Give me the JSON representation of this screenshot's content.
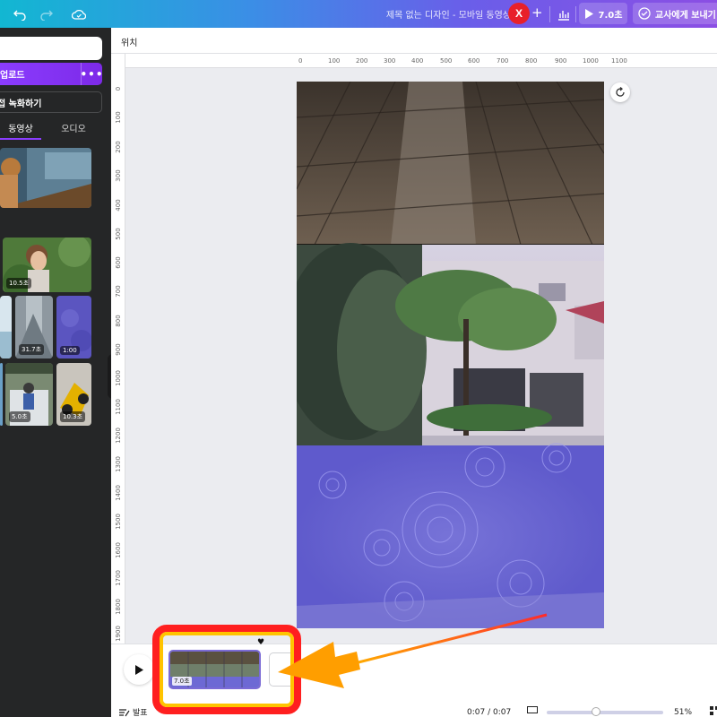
{
  "topbar": {
    "title": "제목 없는 디자인 - 모바일 동영상",
    "avatar_letter": "X",
    "add": "+",
    "play_duration": "7.0초",
    "send_teacher": "교사에게 보내기"
  },
  "sidebar": {
    "upload_label": "업로드",
    "more": "•••",
    "record_label": "접 녹화하기",
    "tabs": [
      "동영상",
      "오디오"
    ],
    "durations": [
      "10.5초",
      "31.7초",
      "1:00",
      "5.0초",
      "10.3초"
    ],
    "collapse": "‹"
  },
  "editor": {
    "position_label": "위치",
    "ruler_h": [
      "0",
      "100",
      "200",
      "300",
      "400",
      "500",
      "600",
      "700",
      "800",
      "900",
      "1000",
      "1100"
    ],
    "ruler_v": [
      "0",
      "100",
      "200",
      "300",
      "400",
      "500",
      "600",
      "700",
      "800",
      "900",
      "1000",
      "1100",
      "1200",
      "1300",
      "1400",
      "1500",
      "1600",
      "1700",
      "1800",
      "1900"
    ]
  },
  "timeline": {
    "clip_duration": "7.0초",
    "notes_label": "발표",
    "timecode": "0:07 / 0:07",
    "zoom": "51%"
  },
  "colors": {
    "annotation_box": "#ff1f1f",
    "annotation_arrow": "#ff9900",
    "accent": "#8b3dff"
  }
}
